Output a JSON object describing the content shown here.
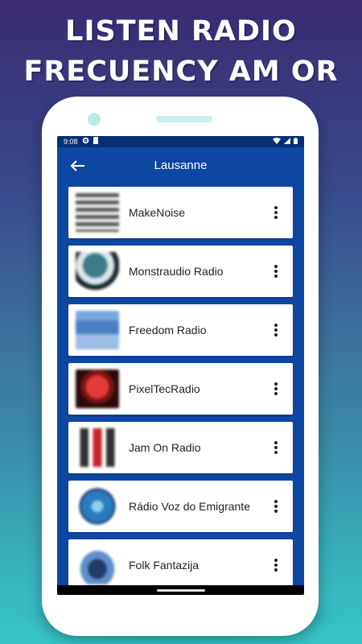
{
  "headline": {
    "line1": "LISTEN RADIO",
    "line2": "FRECUENCY AM OR FM"
  },
  "status_bar": {
    "time": "9:08"
  },
  "app_bar": {
    "title": "Lausanne"
  },
  "stations": [
    {
      "name": "MakeNoise",
      "logo_color": "#6a6a6a"
    },
    {
      "name": "Monstraudio Radio",
      "logo_color": "#3b7c85"
    },
    {
      "name": "Freedom Radio",
      "logo_color": "#5b8fd0"
    },
    {
      "name": "PixelTecRadio",
      "logo_color": "#c0282c"
    },
    {
      "name": "Jam On Radio",
      "logo_color": "#b4252d"
    },
    {
      "name": "Rádio Voz do Emigrante",
      "logo_color": "#2c7bc0"
    },
    {
      "name": "Folk Fantazija",
      "logo_color": "#3c6fa8"
    }
  ],
  "colors": {
    "app_primary": "#0d47a1",
    "status_bar": "#082f73",
    "background_top": "#3a2a72",
    "background_bottom": "#36c6c9"
  }
}
